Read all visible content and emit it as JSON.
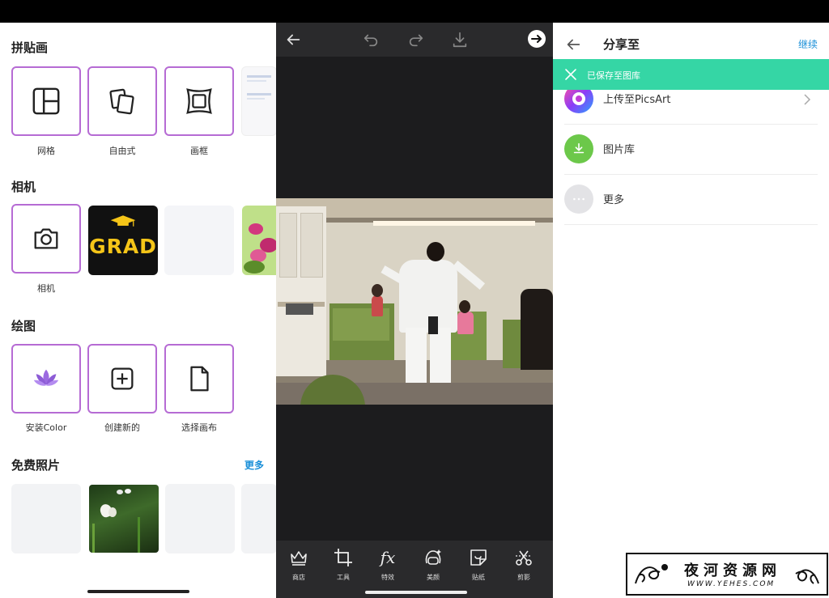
{
  "panel1": {
    "collage": {
      "title": "拼贴画",
      "items": [
        {
          "label": "网格",
          "icon": "grid-layout-icon"
        },
        {
          "label": "自由式",
          "icon": "freestyle-icon"
        },
        {
          "label": "画框",
          "icon": "frame-icon"
        }
      ]
    },
    "camera": {
      "title": "相机",
      "item_label": "相机",
      "icon": "camera-icon",
      "grad_text": "GRAD"
    },
    "draw": {
      "title": "绘图",
      "items": [
        {
          "label": "安装Color",
          "icon": "lotus-icon"
        },
        {
          "label": "创建新的",
          "icon": "add-square-icon"
        },
        {
          "label": "选择画布",
          "icon": "blank-page-icon"
        }
      ]
    },
    "free_photos": {
      "title": "免费照片",
      "more": "更多"
    }
  },
  "panel2": {
    "top_icons": [
      "back-arrow-icon",
      "undo-icon",
      "redo-icon",
      "download-icon",
      "next-arrow-icon"
    ],
    "tools": [
      {
        "label": "商店",
        "icon": "crown-icon"
      },
      {
        "label": "工具",
        "icon": "crop-icon"
      },
      {
        "label": "特效",
        "icon": "fx-icon"
      },
      {
        "label": "美颜",
        "icon": "beauty-icon"
      },
      {
        "label": "贴纸",
        "icon": "sticker-icon"
      },
      {
        "label": "剪影",
        "icon": "cutout-icon"
      }
    ],
    "fx_text": "fx"
  },
  "panel3": {
    "title": "分享至",
    "continue": "继续",
    "toast": "已保存至图库",
    "rows": [
      {
        "label": "上传至PicsArt",
        "icon": "picsart-icon"
      },
      {
        "label": "图片库",
        "icon": "gallery-download-icon"
      },
      {
        "label": "更多",
        "icon": "more-dots-icon"
      }
    ]
  },
  "watermark": {
    "title": "夜河资源网",
    "url": "WWW.YEHES.COM"
  },
  "colors": {
    "accent_purple": "#b66bd4",
    "link_blue": "#1a8fd8",
    "toast_green": "#35d6a5",
    "grad_yellow": "#f5c518"
  }
}
